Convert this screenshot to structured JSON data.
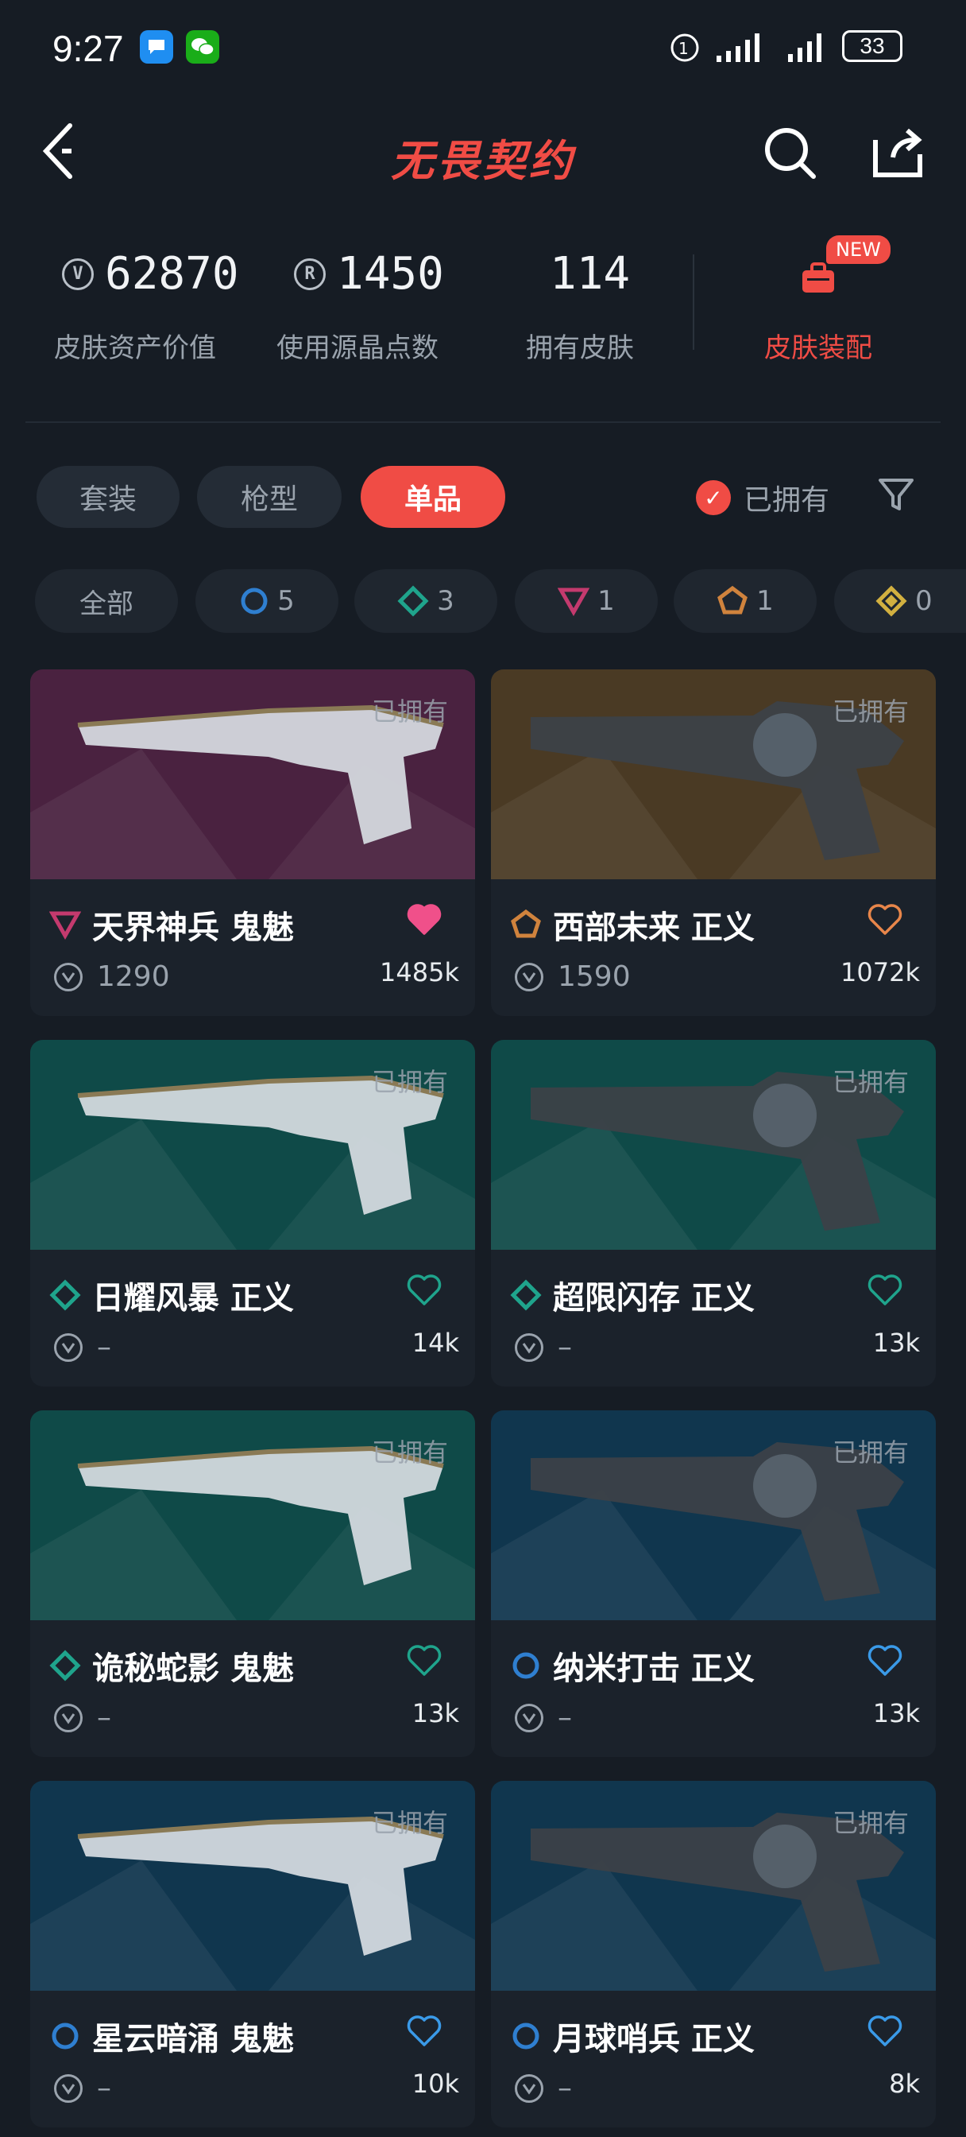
{
  "status_bar": {
    "time": "9:27",
    "battery": "33"
  },
  "header": {
    "title": "无畏契约"
  },
  "stats": [
    {
      "value": "62870",
      "label": "皮肤资产价值",
      "icon": "vp-coin-icon"
    },
    {
      "value": "1450",
      "label": "使用源晶点数",
      "icon": "radianite-icon"
    },
    {
      "value": "114",
      "label": "拥有皮肤"
    }
  ],
  "loadout": {
    "label": "皮肤装配",
    "badge": "NEW"
  },
  "tabs": [
    {
      "label": "套装"
    },
    {
      "label": "枪型"
    },
    {
      "label": "单品",
      "active": true
    }
  ],
  "owned_filter": {
    "label": "已拥有",
    "checked": true
  },
  "rarity_chips": [
    {
      "label": "全部"
    },
    {
      "count": "5",
      "tier": "select",
      "color": "#2f7fd0"
    },
    {
      "count": "3",
      "tier": "deluxe",
      "color": "#1fa48c"
    },
    {
      "count": "1",
      "tier": "premium",
      "color": "#c43a6e"
    },
    {
      "count": "1",
      "tier": "exclusive",
      "color": "#d0833d"
    },
    {
      "count": "0",
      "tier": "ultra",
      "color": "#d2b040"
    }
  ],
  "cards": [
    {
      "name": "天界神兵 鬼魅",
      "price": "1290",
      "likes": "1485k",
      "owned": "已拥有",
      "tier_color": "#c43a6e",
      "tier_shape": "triangle",
      "heart_filled": true,
      "heart_color": "#f0508a",
      "bg": "#4a2240"
    },
    {
      "name": "西部未来 正义",
      "price": "1590",
      "likes": "1072k",
      "owned": "已拥有",
      "tier_color": "#d0833d",
      "tier_shape": "pentagon",
      "heart_filled": false,
      "heart_color": "#e8864a",
      "bg": "#4a3a24"
    },
    {
      "name": "日耀风暴 正义",
      "price": "–",
      "likes": "14k",
      "owned": "已拥有",
      "tier_color": "#1fa48c",
      "tier_shape": "diamond",
      "heart_filled": false,
      "heart_color": "#1fa48c",
      "bg": "#0f4a48"
    },
    {
      "name": "超限闪存 正义",
      "price": "–",
      "likes": "13k",
      "owned": "已拥有",
      "tier_color": "#1fa48c",
      "tier_shape": "diamond",
      "heart_filled": false,
      "heart_color": "#1fa48c",
      "bg": "#0f4a48"
    },
    {
      "name": "诡秘蛇影 鬼魅",
      "price": "–",
      "likes": "13k",
      "owned": "已拥有",
      "tier_color": "#1fa48c",
      "tier_shape": "diamond",
      "heart_filled": false,
      "heart_color": "#1fa48c",
      "bg": "#0f4a48"
    },
    {
      "name": "纳米打击 正义",
      "price": "–",
      "likes": "13k",
      "owned": "已拥有",
      "tier_color": "#2f7fd0",
      "tier_shape": "circle",
      "heart_filled": false,
      "heart_color": "#3a9ae8",
      "bg": "#10364e"
    },
    {
      "name": "星云暗涌 鬼魅",
      "price": "–",
      "likes": "10k",
      "owned": "已拥有",
      "tier_color": "#2f7fd0",
      "tier_shape": "circle",
      "heart_filled": false,
      "heart_color": "#3a9ae8",
      "bg": "#10364e"
    },
    {
      "name": "月球哨兵 正义",
      "price": "–",
      "likes": "8k",
      "owned": "已拥有",
      "tier_color": "#2f7fd0",
      "tier_shape": "circle",
      "heart_filled": false,
      "heart_color": "#3a9ae8",
      "bg": "#10364e"
    }
  ]
}
